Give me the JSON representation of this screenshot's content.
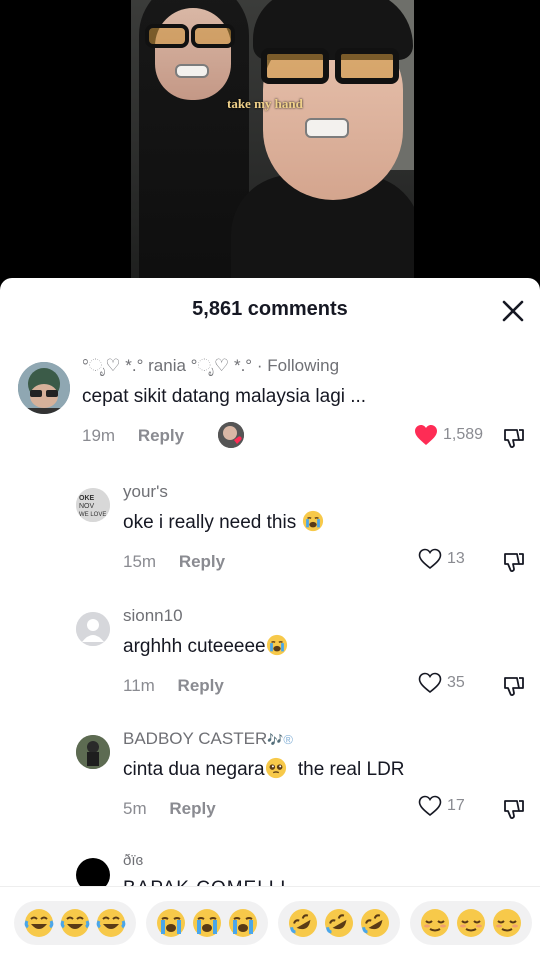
{
  "video": {
    "caption": "take my hand"
  },
  "sheet": {
    "comment_count": "5,861 comments"
  },
  "comments": [
    {
      "username": "°ೃ♡ *.° rania °ೃ♡ *.°",
      "following": "· Following",
      "text": "cepat sikit datang malaysia lagi ...",
      "time": "19m",
      "reply": "Reply",
      "likes": "1,589",
      "liked": true
    },
    {
      "username": "your's",
      "text": "oke i really need this",
      "time": "15m",
      "reply": "Reply",
      "likes": "13",
      "avatar_text": "OKE NOV WE LOVE IT"
    },
    {
      "username": "sionn10",
      "text": "arghhh cuteeeee",
      "time": "11m",
      "reply": "Reply",
      "likes": "35"
    },
    {
      "username": "BADBOY CASTER",
      "username_suffix": "🎶®",
      "text": "cinta dua negara",
      "text_after": "the real LDR",
      "time": "5m",
      "reply": "Reply",
      "likes": "17"
    },
    {
      "username": "ðïɞ",
      "text": "BAPAK COMELLL"
    }
  ],
  "emoji_bar": [
    {
      "name": "laughing-tears",
      "count": 3
    },
    {
      "name": "crying-loud",
      "count": 3
    },
    {
      "name": "rolling-laugh",
      "count": 3
    },
    {
      "name": "relieved",
      "count": 3
    }
  ],
  "colors": {
    "like_red": "#fe2c55",
    "text_dark": "#161823",
    "text_gray": "#8a8b91"
  }
}
